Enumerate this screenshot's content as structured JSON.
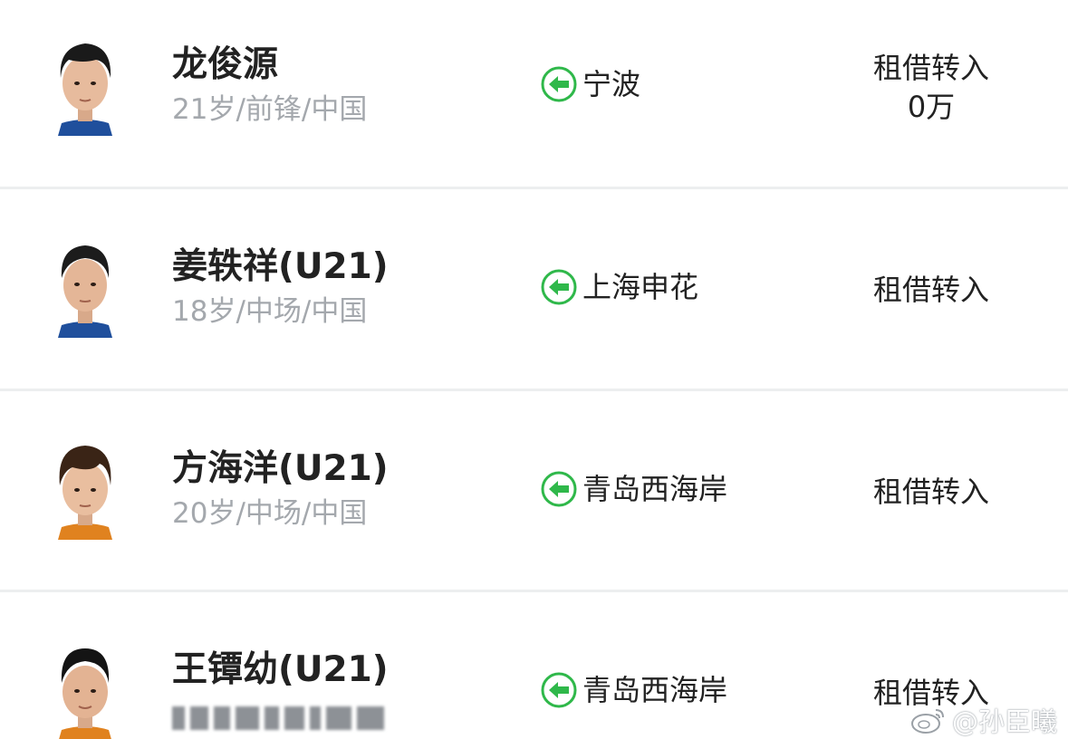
{
  "players": [
    {
      "name": "龙俊源",
      "meta": "21岁/前锋/中国",
      "club": "宁波",
      "transfer_type": "租借转入",
      "fee": "0万",
      "direction_icon": "arrow-left-in-icon",
      "avatar_icon": "player-photo"
    },
    {
      "name": "姜轶祥(U21)",
      "meta": "18岁/中场/中国",
      "club": "上海申花",
      "transfer_type": "租借转入",
      "fee": "",
      "direction_icon": "arrow-left-in-icon",
      "avatar_icon": "player-photo"
    },
    {
      "name": "方海洋(U21)",
      "meta": "20岁/中场/中国",
      "club": "青岛西海岸",
      "transfer_type": "租借转入",
      "fee": "",
      "direction_icon": "arrow-left-in-icon",
      "avatar_icon": "player-photo"
    },
    {
      "name": "王镡幼(U21)",
      "meta": "",
      "club": "青岛西海岸",
      "transfer_type": "租借转入",
      "fee": "",
      "direction_icon": "arrow-left-in-icon",
      "avatar_icon": "player-photo"
    }
  ],
  "watermark": {
    "text": "@孙臣曦",
    "icon": "weibo-icon"
  },
  "colors": {
    "accent_green": "#2fb84a",
    "text_primary": "#222222",
    "text_secondary": "#a4a8ad",
    "divider": "#eceeef"
  }
}
